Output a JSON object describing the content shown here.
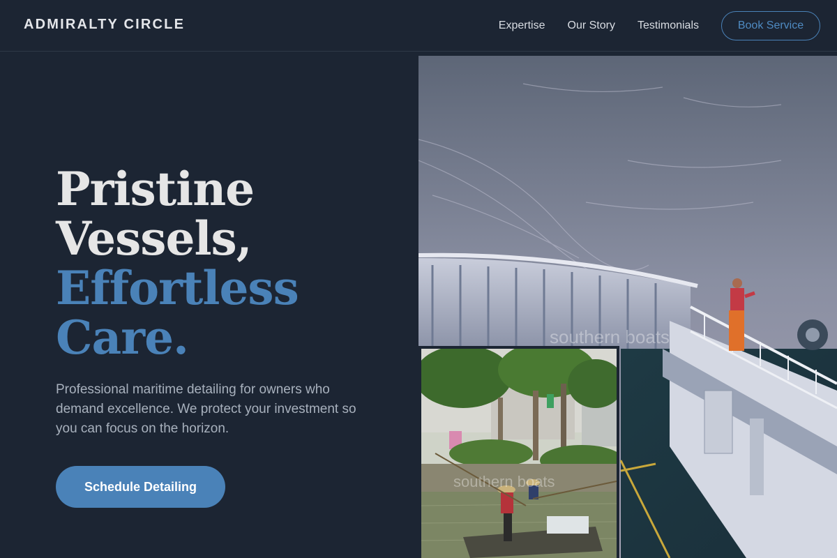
{
  "header": {
    "brand": "ADMIRALTY CIRCLE",
    "nav": [
      "Expertise",
      "Our Story",
      "Testimonials"
    ],
    "cta": "Book Service"
  },
  "hero": {
    "headline_lines": [
      "Pristine",
      "Vessels,",
      "Effortless",
      "Care."
    ],
    "subcopy": "Professional maritime detailing for owners who demand excellence. We protect your investment so you can focus on the horizon.",
    "cta": "Schedule Detailing"
  },
  "images": {
    "main_watermark": "southern boats",
    "inset_watermark": "southern boats"
  },
  "colors": {
    "background": "#1c2533",
    "accent": "#4a82b8",
    "text": "#e6e6e6",
    "muted": "#a8b1bd"
  }
}
